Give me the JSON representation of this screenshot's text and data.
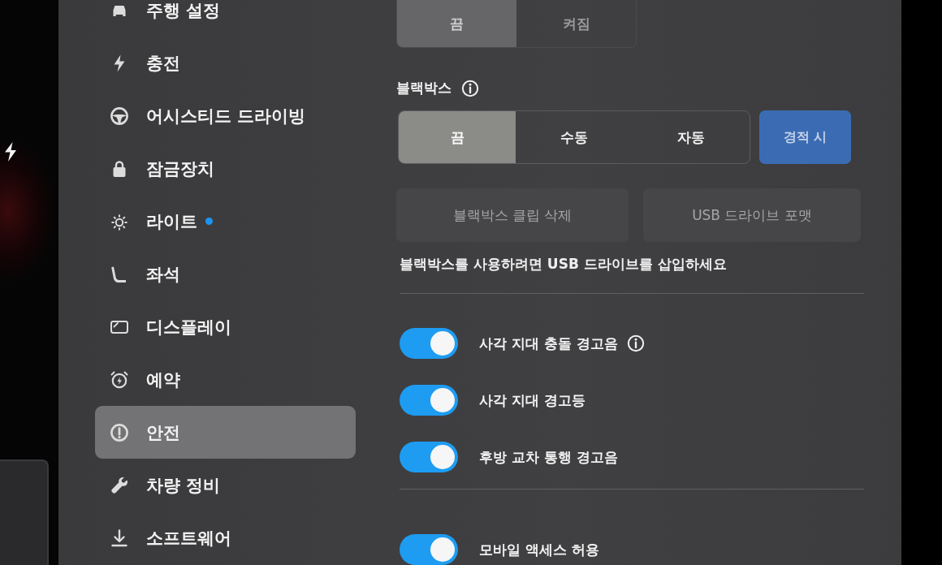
{
  "sidebar": {
    "items": [
      {
        "label": "주행 설정",
        "selected": false,
        "dot": false
      },
      {
        "label": "충전",
        "selected": false,
        "dot": false
      },
      {
        "label": "어시스티드 드라이빙",
        "selected": false,
        "dot": false
      },
      {
        "label": "잠금장치",
        "selected": false,
        "dot": false
      },
      {
        "label": "라이트",
        "selected": false,
        "dot": true
      },
      {
        "label": "좌석",
        "selected": false,
        "dot": false
      },
      {
        "label": "디스플레이",
        "selected": false,
        "dot": false
      },
      {
        "label": "예약",
        "selected": false,
        "dot": false
      },
      {
        "label": "안전",
        "selected": true,
        "dot": false
      },
      {
        "label": "차량 정비",
        "selected": false,
        "dot": false
      },
      {
        "label": "소프트웨어",
        "selected": false,
        "dot": false
      }
    ]
  },
  "top_segment": {
    "options": [
      {
        "label": "끔",
        "selected": true
      },
      {
        "label": "켜짐",
        "selected": false
      }
    ]
  },
  "dashcam": {
    "title": "블랙박스",
    "options": [
      {
        "label": "끔",
        "selected": true
      },
      {
        "label": "수동",
        "selected": false
      },
      {
        "label": "자동",
        "selected": false
      }
    ],
    "honk_button": {
      "label": "경적 시",
      "on": true
    },
    "actions": [
      {
        "label": "블랙박스 클립 삭제",
        "disabled": true
      },
      {
        "label": "USB 드라이브 포맷",
        "disabled": true
      }
    ],
    "message": "블랙박스를 사용하려면 USB 드라이브를 삽입하세요"
  },
  "safety_toggles": [
    {
      "label": "사각 지대 충돌 경고음",
      "on": true,
      "info": true
    },
    {
      "label": "사각 지대 경고등",
      "on": true,
      "info": false
    },
    {
      "label": "후방 교차 통행 경고음",
      "on": true,
      "info": false
    }
  ],
  "access_toggles": [
    {
      "label": "모바일 액세스 허용",
      "on": true,
      "info": false
    }
  ]
}
